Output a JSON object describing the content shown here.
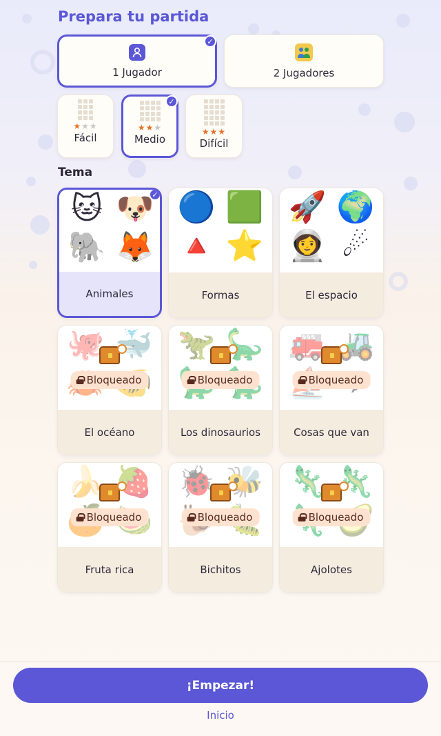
{
  "header": {
    "title": "Prepara tu partida"
  },
  "players": [
    {
      "label": "1 Jugador",
      "icon": "single-player-icon",
      "selected": true
    },
    {
      "label": "2 Jugadores",
      "icon": "two-players-icon",
      "selected": false
    }
  ],
  "difficulty": [
    {
      "label": "Fácil",
      "stars": 1,
      "selected": false
    },
    {
      "label": "Medio",
      "stars": 2,
      "selected": true
    },
    {
      "label": "Difícil",
      "stars": 3,
      "selected": false
    }
  ],
  "theme_section": {
    "label": "Tema"
  },
  "themes": [
    {
      "label": "Animales",
      "locked": false,
      "selected": true,
      "glyphs": [
        "🐱",
        "🐶",
        "🐘",
        "🦊"
      ]
    },
    {
      "label": "Formas",
      "locked": false,
      "selected": false,
      "glyphs": [
        "🔵",
        "🟩",
        "🔺",
        "⭐"
      ]
    },
    {
      "label": "El espacio",
      "locked": false,
      "selected": false,
      "glyphs": [
        "🚀",
        "🌍",
        "👩‍🚀",
        "☄"
      ]
    },
    {
      "label": "El océano",
      "locked": true,
      "selected": false,
      "badge": "Bloqueado",
      "glyphs": [
        "🐙",
        "🐳",
        "🦀",
        "🐠"
      ]
    },
    {
      "label": "Los dinosaurios",
      "locked": true,
      "selected": false,
      "badge": "Bloqueado",
      "glyphs": [
        "🦖",
        "🦕",
        "🦕",
        "🦕"
      ]
    },
    {
      "label": "Cosas que van",
      "locked": true,
      "selected": false,
      "badge": "Bloqueado",
      "glyphs": [
        "🚒",
        "🚜",
        "⛵",
        "✈"
      ]
    },
    {
      "label": "Fruta rica",
      "locked": true,
      "selected": false,
      "badge": "Bloqueado",
      "glyphs": [
        "🍌",
        "🍓",
        "🍊",
        "🍉"
      ]
    },
    {
      "label": "Bichitos",
      "locked": true,
      "selected": false,
      "badge": "Bloqueado",
      "glyphs": [
        "🐞",
        "🐝",
        "🐌",
        "🐛"
      ]
    },
    {
      "label": "Ajolotes",
      "locked": true,
      "selected": false,
      "badge": "Bloqueado",
      "glyphs": [
        "🦎",
        "🦎",
        "🦎",
        "🥑"
      ]
    }
  ],
  "actions": {
    "start_label": "¡Empezar!",
    "home_label": "Inicio"
  },
  "colors": {
    "accent": "#5b57d6",
    "star": "#e5722a",
    "lock_badge": "#fde3cf"
  }
}
